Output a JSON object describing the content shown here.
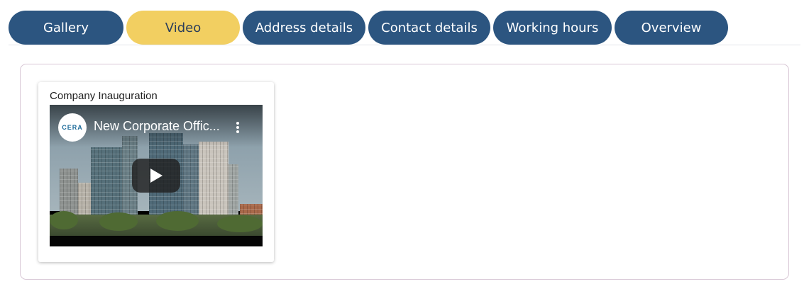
{
  "tabs": [
    {
      "label": "Gallery",
      "active": false
    },
    {
      "label": "Video",
      "active": true
    },
    {
      "label": "Address details",
      "active": false
    },
    {
      "label": "Contact details",
      "active": false
    },
    {
      "label": "Working hours",
      "active": false
    },
    {
      "label": "Overview",
      "active": false
    }
  ],
  "colors": {
    "tab_bg": "#2c5580",
    "tab_active_bg": "#f2cf61",
    "tab_active_text": "#2b3e5a"
  },
  "video_card": {
    "title": "Company Inauguration",
    "player": {
      "channel_logo_text": "CERA",
      "video_title": "New Corporate Offic...",
      "menu_icon": "kebab-menu-icon",
      "play_icon": "play-icon"
    }
  }
}
